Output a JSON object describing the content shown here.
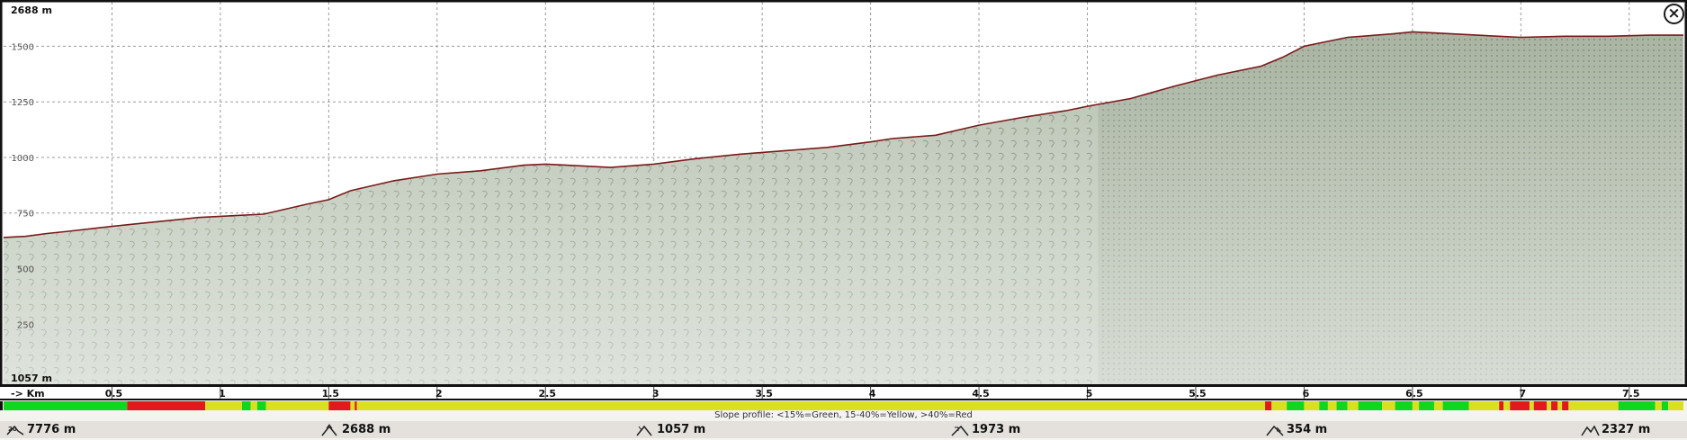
{
  "chart_data": {
    "type": "area",
    "title": "",
    "x_unit_label": "-> Km",
    "y_top_label": "2688 m",
    "y_bottom_label": "1057 m",
    "xlim": [
      0,
      7.75
    ],
    "ylim": [
      -20,
      1700
    ],
    "y_ticks": [
      1500,
      1250,
      1000,
      750,
      500,
      250
    ],
    "x_ticks": [
      "0.5",
      "1",
      "1.5",
      "2",
      "2.5",
      "3",
      "3.5",
      "4",
      "4.5",
      "5",
      "5.5",
      "6",
      "6.5",
      "7",
      "7.5"
    ],
    "grid": true,
    "x": [
      0,
      0.1,
      0.2,
      0.3,
      0.5,
      0.6,
      0.8,
      0.9,
      1.0,
      1.2,
      1.4,
      1.5,
      1.6,
      1.8,
      2.0,
      2.2,
      2.4,
      2.5,
      2.6,
      2.8,
      3.0,
      3.2,
      3.4,
      3.6,
      3.8,
      4.0,
      4.1,
      4.3,
      4.5,
      4.7,
      4.9,
      5.0,
      5.2,
      5.4,
      5.6,
      5.8,
      5.9,
      6.0,
      6.2,
      6.4,
      6.5,
      6.6,
      6.8,
      7.0,
      7.2,
      7.4,
      7.6,
      7.75
    ],
    "y": [
      640,
      645,
      658,
      668,
      690,
      700,
      720,
      730,
      735,
      745,
      790,
      810,
      850,
      895,
      925,
      940,
      965,
      970,
      965,
      955,
      970,
      995,
      1015,
      1030,
      1045,
      1070,
      1085,
      1100,
      1145,
      1180,
      1210,
      1230,
      1265,
      1320,
      1370,
      1410,
      1450,
      1500,
      1540,
      1555,
      1565,
      1560,
      1550,
      1540,
      1545,
      1545,
      1550,
      1550
    ],
    "slope_segments": [
      [
        0.0,
        0.57,
        "g"
      ],
      [
        0.57,
        0.93,
        "r"
      ],
      [
        0.93,
        1.1,
        "y"
      ],
      [
        1.1,
        1.14,
        "g"
      ],
      [
        1.14,
        1.17,
        "y"
      ],
      [
        1.17,
        1.21,
        "g"
      ],
      [
        1.21,
        1.5,
        "y"
      ],
      [
        1.5,
        1.6,
        "r"
      ],
      [
        1.6,
        1.62,
        "y"
      ],
      [
        1.62,
        1.63,
        "r"
      ],
      [
        1.63,
        5.82,
        "y"
      ],
      [
        5.82,
        5.85,
        "r"
      ],
      [
        5.85,
        5.92,
        "y"
      ],
      [
        5.92,
        6.0,
        "g"
      ],
      [
        6.0,
        6.07,
        "y"
      ],
      [
        6.07,
        6.11,
        "g"
      ],
      [
        6.11,
        6.15,
        "y"
      ],
      [
        6.15,
        6.2,
        "g"
      ],
      [
        6.2,
        6.25,
        "y"
      ],
      [
        6.25,
        6.36,
        "g"
      ],
      [
        6.36,
        6.42,
        "y"
      ],
      [
        6.42,
        6.5,
        "g"
      ],
      [
        6.5,
        6.53,
        "y"
      ],
      [
        6.53,
        6.6,
        "g"
      ],
      [
        6.6,
        6.64,
        "y"
      ],
      [
        6.64,
        6.76,
        "g"
      ],
      [
        6.76,
        6.9,
        "y"
      ],
      [
        6.9,
        6.92,
        "r"
      ],
      [
        6.92,
        6.95,
        "y"
      ],
      [
        6.95,
        7.04,
        "r"
      ],
      [
        7.04,
        7.06,
        "y"
      ],
      [
        7.06,
        7.12,
        "r"
      ],
      [
        7.12,
        7.14,
        "y"
      ],
      [
        7.14,
        7.17,
        "r"
      ],
      [
        7.17,
        7.19,
        "y"
      ],
      [
        7.19,
        7.22,
        "r"
      ],
      [
        7.22,
        7.45,
        "y"
      ],
      [
        7.45,
        7.62,
        "g"
      ],
      [
        7.62,
        7.65,
        "y"
      ],
      [
        7.65,
        7.68,
        "g"
      ],
      [
        7.68,
        7.75,
        "y"
      ]
    ]
  },
  "slope_legend": "Slope profile: <15%=Green, 15-40%=Yellow, >40%=Red",
  "stats": {
    "distance": "7776 m",
    "max_elevation": "2688 m",
    "min_elevation": "1057 m",
    "total_ascent": "1973 m",
    "total_descent": "354 m",
    "elevation_gain": "2327 m"
  },
  "colors": {
    "area_fill": "#b7c2b1",
    "area_fill_shaded": "#a9b4a2",
    "profile_line": "#7a1a1a",
    "slope_green": "#11d61f",
    "slope_yellow": "#d9e021",
    "slope_red": "#e01a1a",
    "frame": "#111111"
  }
}
